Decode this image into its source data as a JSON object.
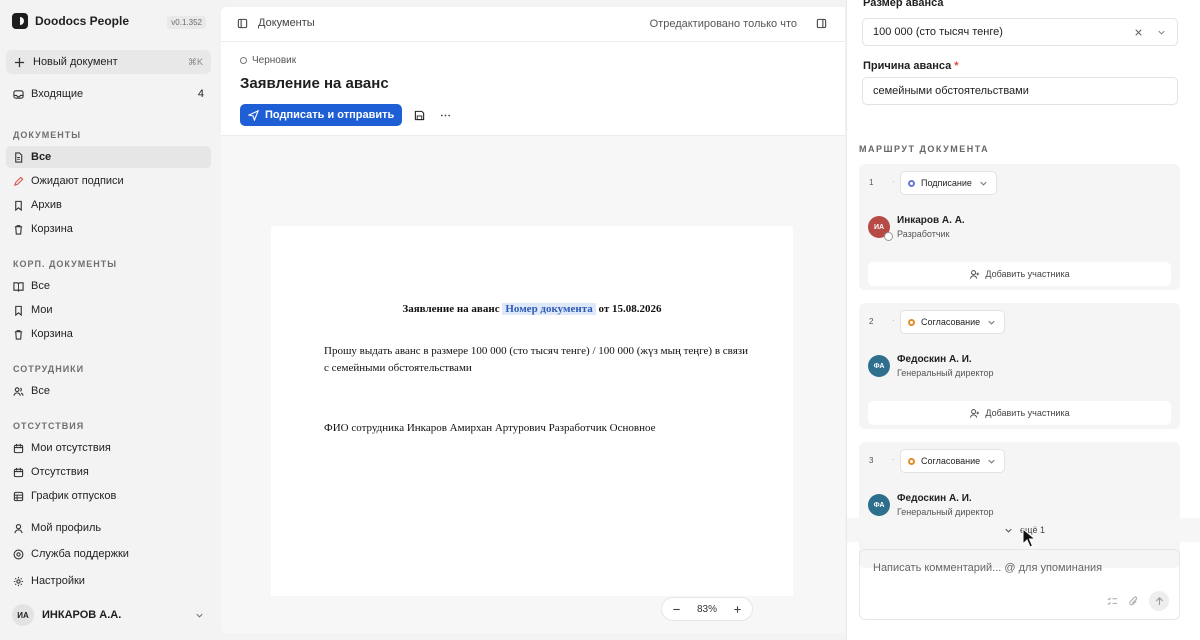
{
  "sidebar": {
    "brand": "Doodocs People",
    "version": "v0.1.352",
    "new_document": "Новый документ",
    "new_document_shortcut": "⌘K",
    "inbox": {
      "label": "Входящие",
      "count": "4"
    },
    "sections": {
      "documents": "ДОКУМЕНТЫ",
      "corp_documents": "КОРП. ДОКУМЕНТЫ",
      "employees": "СОТРУДНИКИ",
      "absences": "ОТСУТСТВИЯ"
    },
    "documents_items": [
      "Все",
      "Ожидают подписи",
      "Архив",
      "Корзина"
    ],
    "corp_items": [
      "Все",
      "Мои",
      "Корзина"
    ],
    "employees_items": [
      "Все"
    ],
    "absences_items": [
      "Мои отсутствия",
      "Отсутствия",
      "График отпусков"
    ],
    "footer_items": [
      "Мой профиль",
      "Служба поддержки",
      "Настройки"
    ],
    "user": {
      "initials": "ИА",
      "name": "ИНКАРОВ А.А."
    }
  },
  "topbar": {
    "breadcrumb": "Документы",
    "edited": "Отредактировано только что"
  },
  "document": {
    "status": "Черновик",
    "title": "Заявление на аванс",
    "sign_button": "Подписать и отправить",
    "paper": {
      "title_prefix": "Заявление на аванс",
      "doc_number": "Номер документа",
      "title_suffix": "от 15.08.2026",
      "body": "Прошу выдать аванс в размере 100 000 (сто тысяч тенге) / 100 000 (жүз мың теңге) в связи с семейными обстоятельствами",
      "fio": "ФИО сотрудника Инкаров Амирхан Артурович Разработчик Основное"
    },
    "zoom": "83%"
  },
  "right_panel": {
    "advance_size_label": "Размер аванса",
    "advance_size_value": "100 000 (сто тысяч тенге)",
    "reason_label": "Причина аванса",
    "reason_required": "*",
    "reason_value": "семейными обстоятельствами",
    "route_title": "МАРШРУТ ДОКУМЕНТА",
    "steps": [
      {
        "num": "1",
        "type": "Подписание",
        "initials": "ИА",
        "name": "Инкаров А. А.",
        "role": "Разработчик",
        "add": "Добавить участника"
      },
      {
        "num": "2",
        "type": "Согласование",
        "initials": "ФА",
        "name": "Федоскин А. И.",
        "role": "Генеральный директор",
        "add": "Добавить участника"
      },
      {
        "num": "3",
        "type": "Согласование",
        "initials": "ФА",
        "name": "Федоскин А. И.",
        "role": "Генеральный директор"
      }
    ],
    "more": "ещё 1",
    "comment_placeholder": "Написать комментарий... @ для упоминания"
  },
  "colors": {
    "accent": "#1f5fd6",
    "signing_dot": "#6a78d1",
    "approval_dot": "#e28b2c",
    "avatar_red": "#b64a45",
    "avatar_teal": "#2f6f8e"
  }
}
